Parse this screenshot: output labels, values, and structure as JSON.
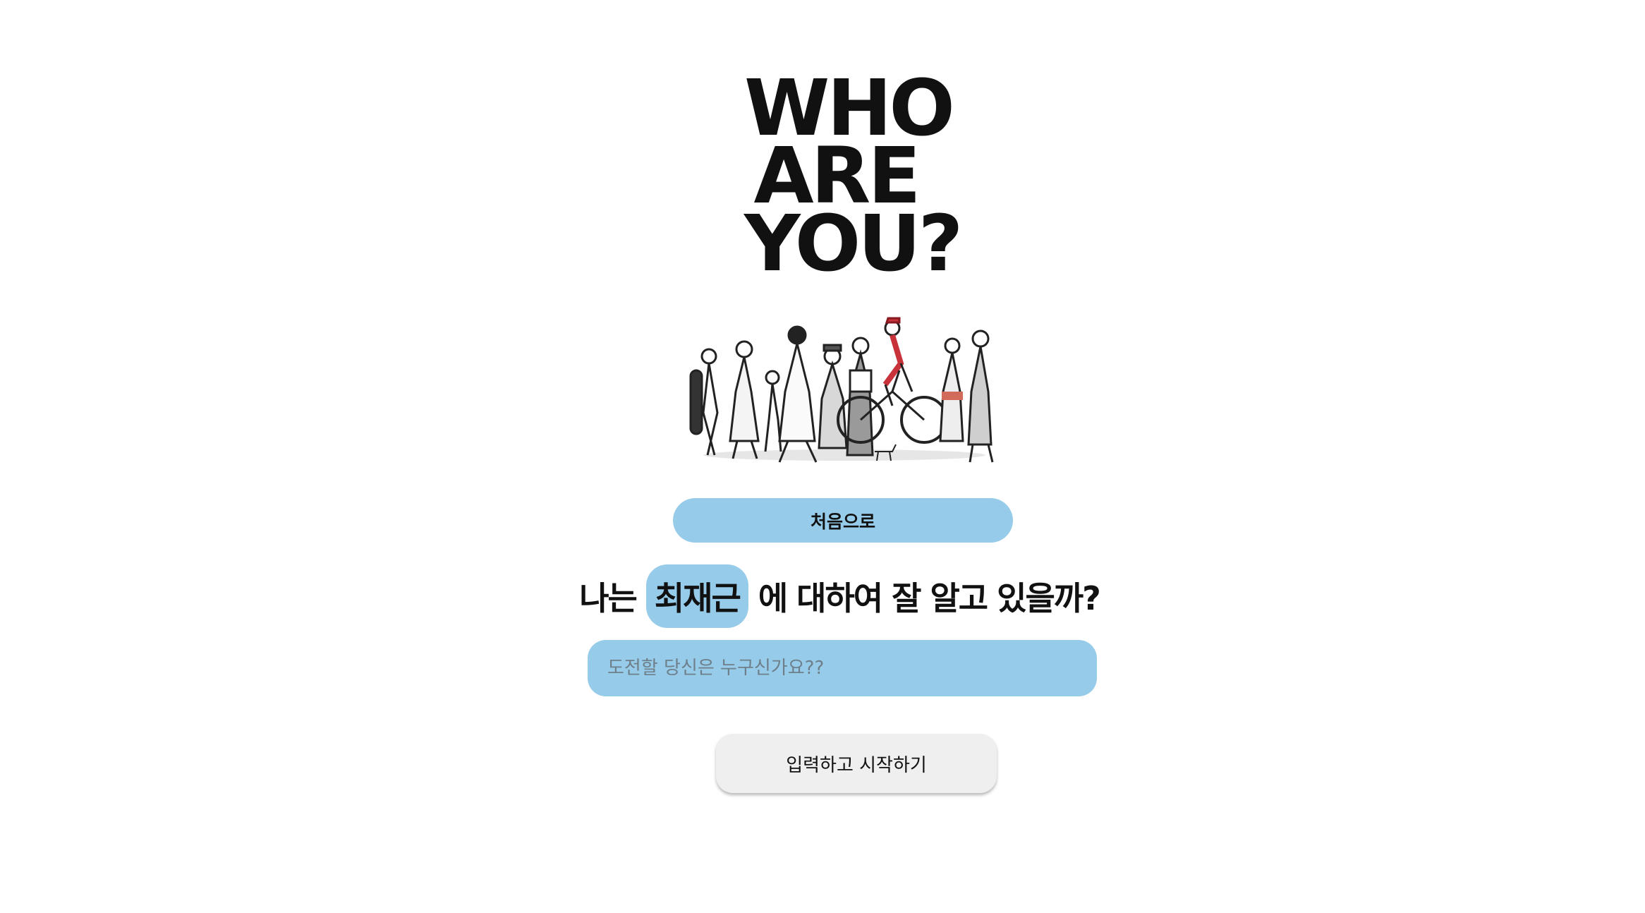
{
  "hero": {
    "title": "WHO\nARE\nYOU?"
  },
  "home_button_label": "처음으로",
  "question": {
    "prefix": "나는",
    "name": "최재근",
    "suffix": "에 대하여 잘 알고 있을까?"
  },
  "name_input": {
    "placeholder": "도전할 당신은 누구신가요??",
    "value": ""
  },
  "start_button_label": "입력하고 시작하기",
  "colors": {
    "accent": "#96cbe9",
    "button_gray": "#efefef",
    "background": "#ffffff",
    "text": "#111111"
  }
}
